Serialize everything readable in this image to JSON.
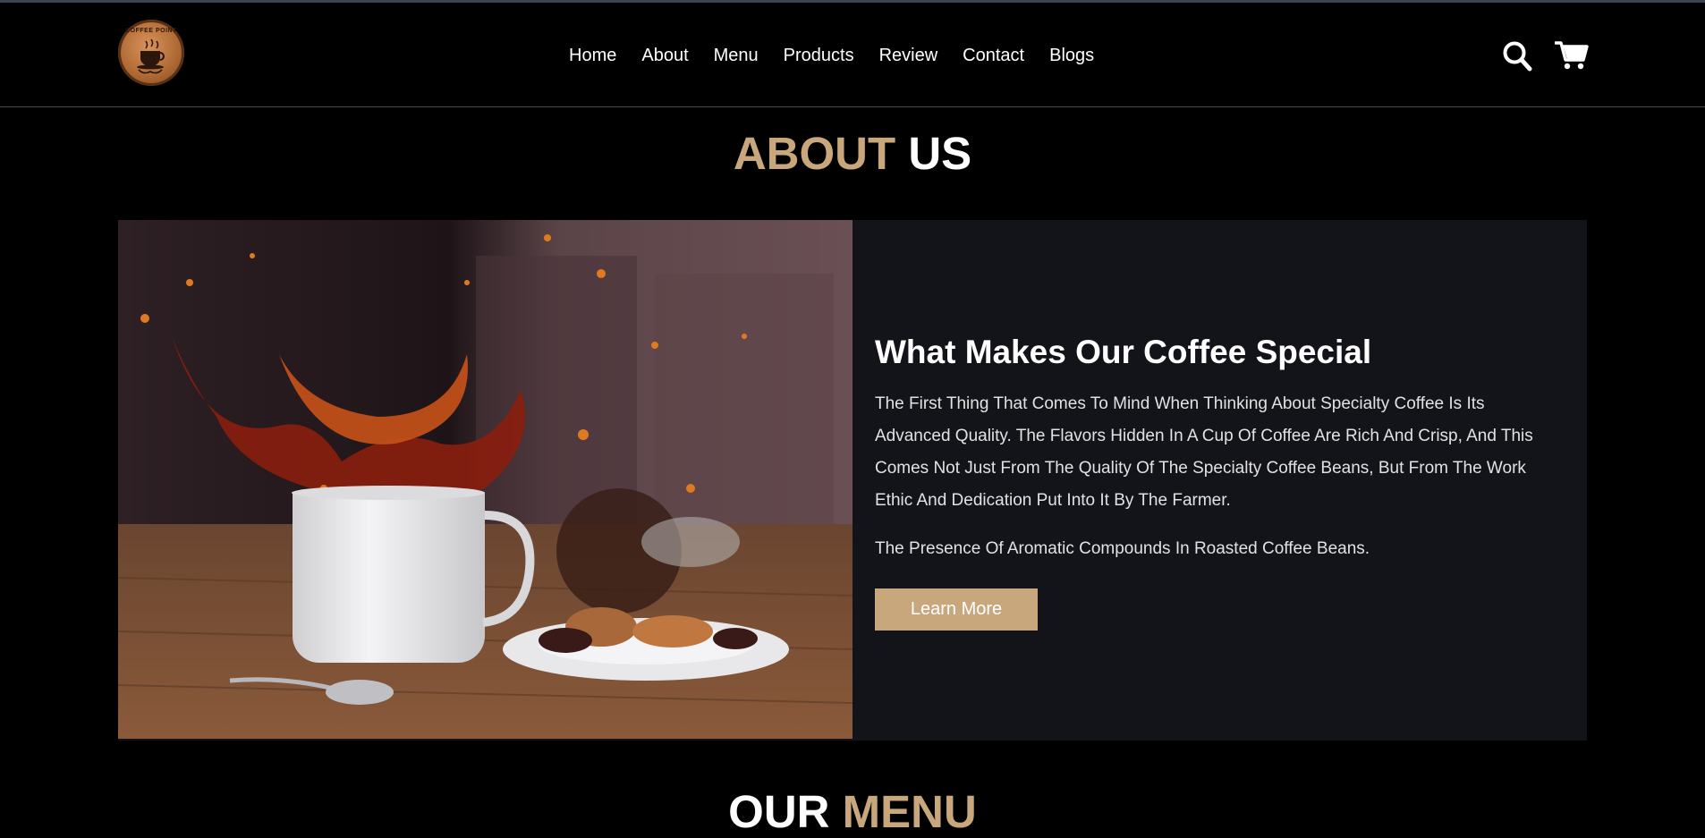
{
  "brand": {
    "logo_text": "COFFEE POINT",
    "logo_icon": "coffee-cup-icon"
  },
  "nav": {
    "items": [
      {
        "label": "Home"
      },
      {
        "label": "About"
      },
      {
        "label": "Menu"
      },
      {
        "label": "Products"
      },
      {
        "label": "Review"
      },
      {
        "label": "Contact"
      },
      {
        "label": "Blogs"
      }
    ]
  },
  "header_icons": {
    "search": "search-icon",
    "cart": "cart-icon"
  },
  "about": {
    "title_part1": "ABOUT",
    "title_part2": "US",
    "heading": "What Makes Our Coffee Special",
    "paragraph1": "The First Thing That Comes To Mind When Thinking About Specialty Coffee Is Its Advanced Quality. The Flavors Hidden In A Cup Of Coffee Are Rich And Crisp, And This Comes Not Just From The Quality Of The Specialty Coffee Beans, But From The Work Ethic And Dedication Put Into It By The Farmer.",
    "paragraph2": "The Presence Of Aromatic Compounds In Roasted Coffee Beans.",
    "button_label": "Learn More"
  },
  "menu_section": {
    "title_part1": "OUR",
    "title_part2": "MENU"
  },
  "colors": {
    "accent": "#c9a77c",
    "background": "#000000",
    "panel": "#13131a"
  }
}
